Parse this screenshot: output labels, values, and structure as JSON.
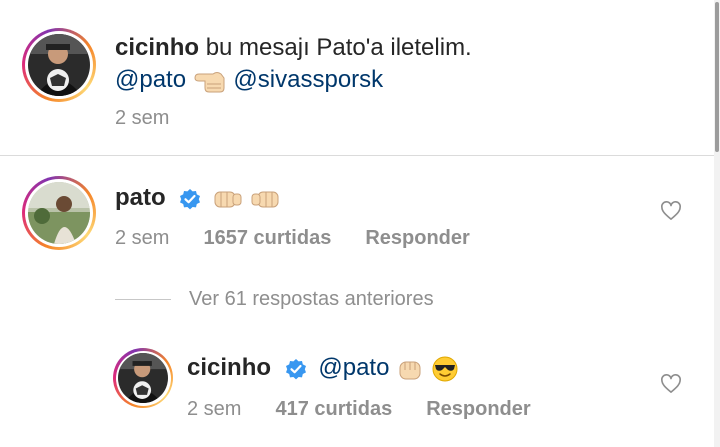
{
  "caption": {
    "username": "cicinho",
    "text_line1": "bu mesajı Pato'a iletelim.",
    "mention1": "@pato",
    "pointing_emoji": "point-left-hand-emoji",
    "mention2": "@sivassporsk",
    "time": "2 sem"
  },
  "comment": {
    "username": "pato",
    "verified": true,
    "emoji_names": [
      "fist-bump-right-emoji",
      "fist-bump-left-emoji"
    ],
    "time": "2 sem",
    "likes": "1657 curtidas",
    "reply_label": "Responder"
  },
  "view_replies": "Ver 61 respostas anteriores",
  "reply": {
    "username": "cicinho",
    "verified": true,
    "mention": "@pato",
    "emoji_names": [
      "fist-emoji",
      "sunglasses-emoji"
    ],
    "time": "2 sem",
    "likes": "417 curtidas",
    "reply_label": "Responder"
  },
  "colors": {
    "username": "#262626",
    "mention": "#00376b",
    "meta": "#8e8e8e",
    "verified": "#3897f0"
  }
}
